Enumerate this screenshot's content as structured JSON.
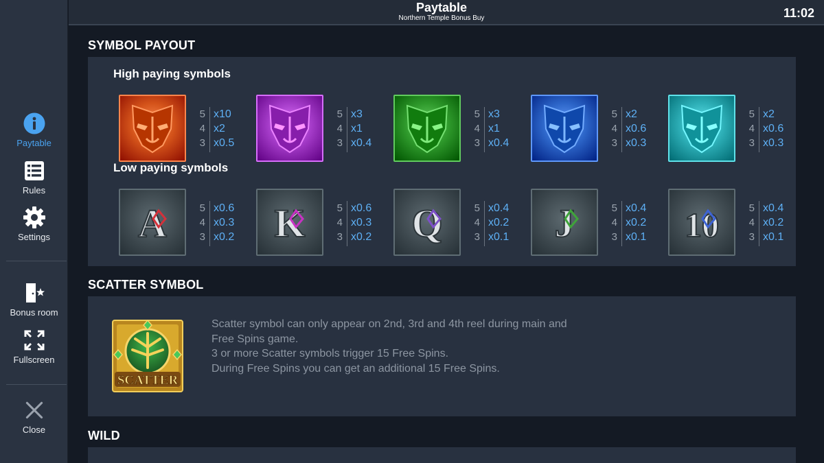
{
  "header": {
    "title": "Paytable",
    "subtitle": "Northern Temple Bonus Buy",
    "clock": "11:02"
  },
  "sidebar": {
    "items": [
      {
        "label": "Paytable",
        "icon": "info-icon",
        "active": true
      },
      {
        "label": "Rules",
        "icon": "list-icon"
      },
      {
        "label": "Settings",
        "icon": "gear-icon"
      },
      {
        "label": "Bonus room",
        "icon": "bonus-door-icon"
      },
      {
        "label": "Fullscreen",
        "icon": "fullscreen-icon"
      },
      {
        "label": "Close",
        "icon": "close-icon"
      }
    ],
    "active_color": "#4aa3f0"
  },
  "sections": {
    "symbol_payout": "SYMBOL PAYOUT",
    "high_paying": "High paying symbols",
    "low_paying": "Low paying symbols",
    "scatter": "SCATTER SYMBOL",
    "wild": "WILD"
  },
  "high_symbols": [
    {
      "name": "boar-mask-symbol",
      "color": "#d4531a",
      "pays": [
        {
          "count": "5",
          "value": "x10"
        },
        {
          "count": "4",
          "value": "x2"
        },
        {
          "count": "3",
          "value": "x0.5"
        }
      ]
    },
    {
      "name": "bull-mask-symbol",
      "color": "#a53cc9",
      "pays": [
        {
          "count": "5",
          "value": "x3"
        },
        {
          "count": "4",
          "value": "x1"
        },
        {
          "count": "3",
          "value": "x0.4"
        }
      ]
    },
    {
      "name": "serpent-mask-symbol",
      "color": "#2f9a2c",
      "pays": [
        {
          "count": "5",
          "value": "x3"
        },
        {
          "count": "4",
          "value": "x1"
        },
        {
          "count": "3",
          "value": "x0.4"
        }
      ]
    },
    {
      "name": "wolf-mask-symbol",
      "color": "#2d66c9",
      "pays": [
        {
          "count": "5",
          "value": "x2"
        },
        {
          "count": "4",
          "value": "x0.6"
        },
        {
          "count": "3",
          "value": "x0.3"
        }
      ]
    },
    {
      "name": "eagle-mask-symbol",
      "color": "#2eb0b8",
      "pays": [
        {
          "count": "5",
          "value": "x2"
        },
        {
          "count": "4",
          "value": "x0.6"
        },
        {
          "count": "3",
          "value": "x0.3"
        }
      ]
    }
  ],
  "low_symbols": [
    {
      "name": "ace-symbol",
      "letter": "A",
      "rune_color": "#d3313a",
      "pays": [
        {
          "count": "5",
          "value": "x0.6"
        },
        {
          "count": "4",
          "value": "x0.3"
        },
        {
          "count": "3",
          "value": "x0.2"
        }
      ]
    },
    {
      "name": "king-symbol",
      "letter": "K",
      "rune_color": "#c832c4",
      "pays": [
        {
          "count": "5",
          "value": "x0.6"
        },
        {
          "count": "4",
          "value": "x0.3"
        },
        {
          "count": "3",
          "value": "x0.2"
        }
      ]
    },
    {
      "name": "queen-symbol",
      "letter": "Q",
      "rune_color": "#7d50c8",
      "pays": [
        {
          "count": "5",
          "value": "x0.4"
        },
        {
          "count": "4",
          "value": "x0.2"
        },
        {
          "count": "3",
          "value": "x0.1"
        }
      ]
    },
    {
      "name": "jack-symbol",
      "letter": "J",
      "rune_color": "#3fa43a",
      "pays": [
        {
          "count": "5",
          "value": "x0.4"
        },
        {
          "count": "4",
          "value": "x0.2"
        },
        {
          "count": "3",
          "value": "x0.1"
        }
      ]
    },
    {
      "name": "ten-symbol",
      "letter": "10",
      "rune_color": "#3d63d4",
      "pays": [
        {
          "count": "5",
          "value": "x0.4"
        },
        {
          "count": "4",
          "value": "x0.2"
        },
        {
          "count": "3",
          "value": "x0.1"
        }
      ]
    }
  ],
  "scatter": {
    "logo_text": "SCATTER",
    "lines": [
      "Scatter symbol can only appear on 2nd, 3rd and 4th reel during main and",
      "Free Spins game.",
      "3 or more Scatter symbols trigger 15 Free Spins.",
      "During Free Spins you can get an additional 15 Free Spins."
    ]
  }
}
